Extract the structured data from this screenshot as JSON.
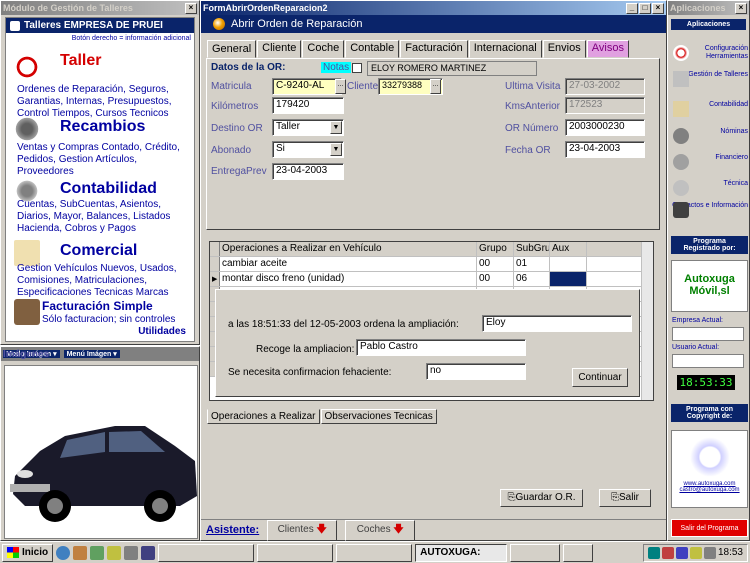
{
  "left_window": {
    "title": "Módulo de Gestión de Talleres",
    "header": "Talleres EMPRESA DE PRUEI",
    "hint": "Botón derecho = información adicional",
    "sections": [
      {
        "title": "Taller",
        "desc": "Ordenes de Reparación, Seguros, Garantias, Internas, Presupuestos, Control Tiempos, Cursos Tecnicos",
        "icon": "clock-icon"
      },
      {
        "title": "Recambios",
        "desc": "Ventas y Compras Contado, Crédito, Pedidos, Gestion Artículos, Proveedores",
        "icon": "parts-icon"
      },
      {
        "title": "Contabilidad",
        "desc": "Cuentas, SubCuentas, Asientos, Diarios, Mayor, Balances, Listados Hacienda, Cobros y Pagos",
        "icon": "money-icon"
      },
      {
        "title": "Comercial",
        "desc": "Gestion Vehículos Nuevos, Usados, Comisiones, Matriculaciones, Especificaciones Tecnicas Marcas",
        "icon": "document-icon"
      },
      {
        "title": "Facturación Simple",
        "desc": "Sólo facturacion; sin controles",
        "icon": "chair-icon"
      }
    ],
    "utilidades": "Utilidades"
  },
  "images_window": {
    "title": "Imágenes",
    "mode_button": "Modo Imágen",
    "menu_button": "Menú Imágen"
  },
  "main_window": {
    "title": "FormAbrirOrdenReparacion2",
    "header": "Abrir Orden de Reparación",
    "tabs": [
      "General",
      "Cliente",
      "Coche",
      "Contable",
      "Facturación",
      "Internacional",
      "Envios",
      "Avisos"
    ],
    "general": {
      "datos_label": "Datos de la OR:",
      "notas_label": "Notas",
      "client_name": "ELOY ROMERO MARTINEZ",
      "matricula_label": "Matricula",
      "matricula": "C-9240-AL",
      "cliente_label": "Cliente",
      "cliente": "33279388",
      "ultima_visita_label": "Ultima Visita",
      "ultima_visita": "27-03-2002",
      "kilometros_label": "Kilómetros",
      "kilometros": "179420",
      "kms_anterior_label": "KmsAnterior",
      "kms_anterior": "172523",
      "destino_label": "Destino OR",
      "destino": "Taller",
      "or_numero_label": "OR Número",
      "or_numero": "2003000230",
      "abonado_label": "Abonado",
      "abonado": "Si",
      "fecha_or_label": "Fecha OR",
      "fecha_or": "23-04-2003",
      "entrega_label": "EntregaPrev",
      "entrega": "23-04-2003"
    },
    "grid": {
      "columns": [
        "Operaciones a Realizar en Vehículo",
        "Grupo",
        "SubGru",
        "Aux"
      ],
      "rows": [
        [
          "cambiar aceite",
          "00",
          "01",
          ""
        ],
        [
          "montar disco freno (unidad)",
          "00",
          "06",
          ""
        ],
        [
          "",
          "",
          "",
          ""
        ],
        [
          "",
          "",
          "",
          ""
        ],
        [
          "",
          "",
          "",
          ""
        ],
        [
          "",
          "",
          "",
          ""
        ],
        [
          "",
          "",
          "",
          ""
        ],
        [
          "",
          "",
          "",
          ""
        ]
      ]
    },
    "dialog": {
      "amplia_label": "a las 18:51:33 del 12-05-2003 ordena la ampliación:",
      "amplia_value": "Eloy",
      "recoge_label": "Recoge la ampliacion:",
      "recoge_value": "Pablo Castro",
      "confirm_label": "Se necesita confirmacion fehaciente:",
      "confirm_value": "no",
      "continuar": "Continuar"
    },
    "bottom_tabs": [
      "Operaciones a Realizar",
      "Observaciones Tecnicas"
    ],
    "guardar": "Guardar O.R.",
    "salir": "Salir",
    "asistente_label": "Asistente:",
    "asistente_buttons": [
      "Clientes",
      "Coches"
    ]
  },
  "right_window": {
    "title": "Aplicaciones",
    "header": "Aplicaciones",
    "items": [
      "Configuración Herramientas",
      "Gestión de Talleres",
      "Contabilidad",
      "Nóminas",
      "Financiero",
      "Técnica",
      "Contactos e Información"
    ],
    "programa_label": "Programa Registrado por:",
    "logo_line1": "Autoxuga",
    "logo_line2": "Móvil,sl",
    "empresa_label": "Empresa Actual:",
    "usuario_label": "Usuario Actual:",
    "clock": "18:53:33",
    "copyright_label": "Programa con Copyright de:",
    "web": "www.autoxuga.com",
    "email": "castro@autoxuga.com",
    "salir_programa": "Salir del Programa"
  },
  "taskbar": {
    "start": "Inicio",
    "active_task": "AUTOXUGA:",
    "time": "18:53"
  }
}
